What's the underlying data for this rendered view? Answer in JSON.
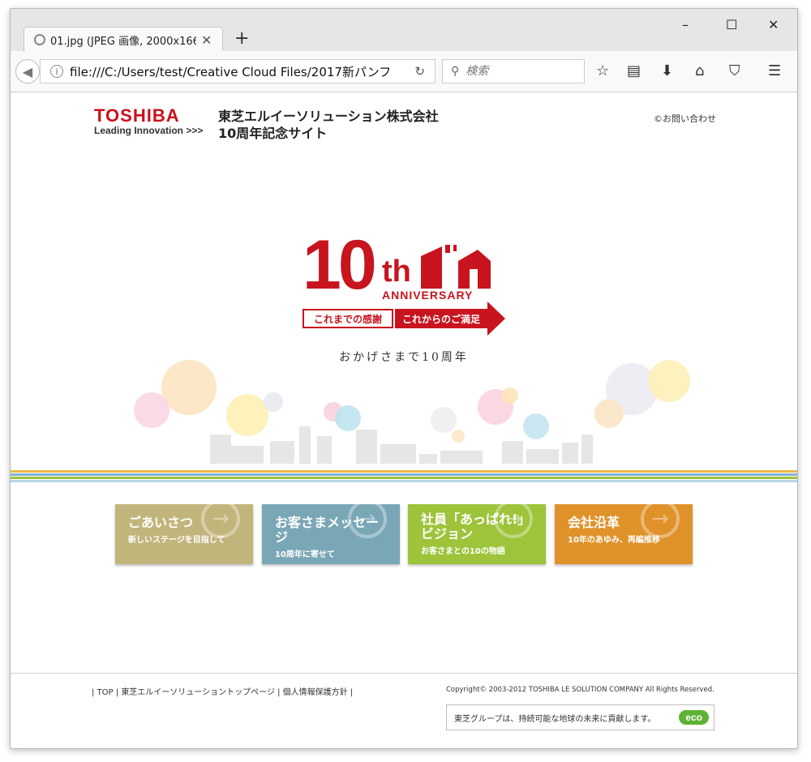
{
  "browser": {
    "tab_title": "01.jpg (JPEG 画像, 2000x166",
    "new_tab": "+",
    "url": "file:///C:/Users/test/Creative Cloud Files/2017新パンフ",
    "search_placeholder": "検索",
    "window_controls": [
      "–",
      "☐",
      "✕"
    ],
    "icons": [
      "back-icon",
      "info-icon",
      "reload-icon",
      "search-icon",
      "star-icon",
      "reading-list-icon",
      "download-icon",
      "home-icon",
      "pocket-icon",
      "menu-icon"
    ]
  },
  "header": {
    "logo_main": "TOSHIBA",
    "logo_sub": "Leading Innovation >>>",
    "site_title_line1": "東芝エルイーソリューション株式会社",
    "site_title_line2": "10周年記念サイト",
    "contact_link": "©お問い合わせ"
  },
  "hero": {
    "number": "10",
    "suffix": "th",
    "anniversary": "ANNIVERSARY",
    "tagline_left": "これまでの感謝",
    "tagline_right": "これからのご満足",
    "subtitle": "おかげさまで10周年"
  },
  "nav_buttons": [
    {
      "title": "ごあいさつ",
      "subtitle": "新しいステージを目指して",
      "color": "#c2b57c"
    },
    {
      "title": "お客さまメッセージ",
      "subtitle": "10周年に寄せて",
      "color": "#7aa7b6"
    },
    {
      "title": "社員「あっぱれ!」ビジョン",
      "subtitle": "お客さまとの10の物語",
      "color": "#9dc43a"
    },
    {
      "title": "会社沿革",
      "subtitle": "10年のあゆみ、再編推移",
      "color": "#e0922a"
    }
  ],
  "footer": {
    "links": [
      "TOP",
      "東芝エルイーソリューショントップページ",
      "個人情報保護方針"
    ],
    "copyright": "Copyright© 2003-2012 TOSHIBA LE SOLUTION COMPANY All Rights Reserved.",
    "eco_text": "東芝グループは、持続可能な地球の未来に貢献します。",
    "eco_badge": "eco"
  },
  "colors": {
    "brand_red": "#cc0f1a",
    "stripe_colors": [
      "#e8b84a",
      "#7fb3d5",
      "#9dc43a",
      "#b9d6e6"
    ]
  }
}
